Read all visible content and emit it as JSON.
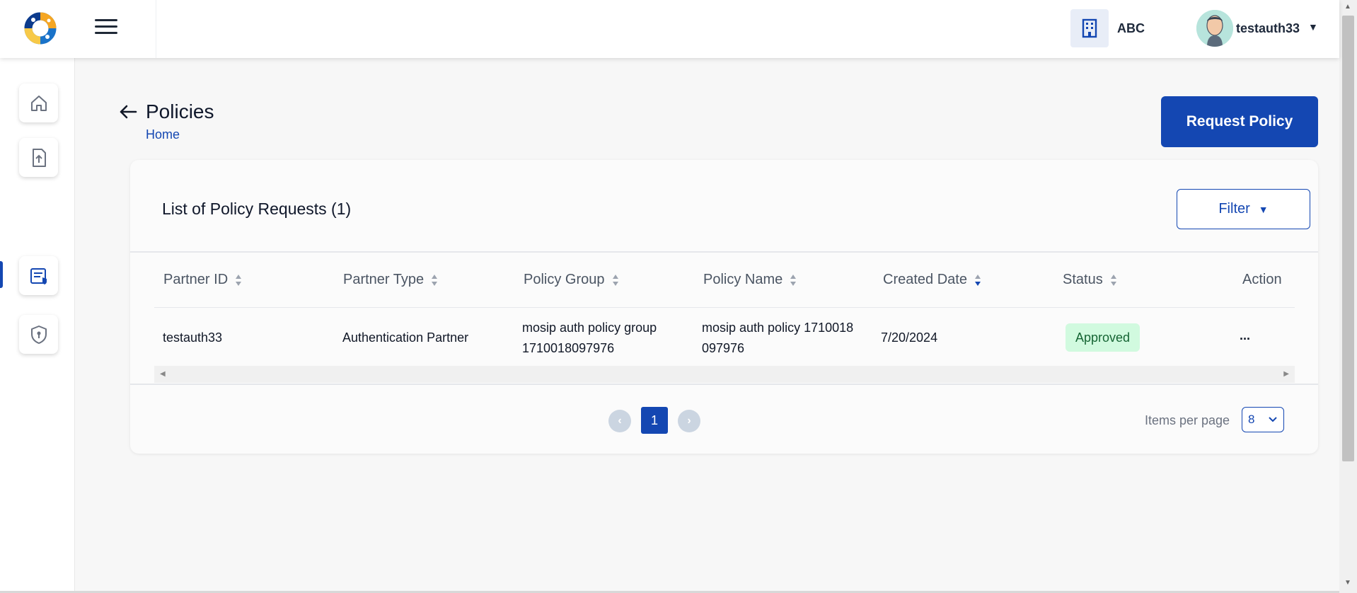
{
  "header": {
    "org_name": "ABC",
    "username": "testauth33",
    "icons": [
      "logo-icon",
      "hamburger-icon",
      "building-icon",
      "avatar",
      "caret-down-icon"
    ]
  },
  "sidebar": {
    "items": [
      {
        "name": "home",
        "icon": "home-icon"
      },
      {
        "name": "upload",
        "icon": "upload-document-icon"
      },
      {
        "name": "policies",
        "icon": "policy-document-icon",
        "active": true
      },
      {
        "name": "security",
        "icon": "shield-icon"
      }
    ]
  },
  "page": {
    "title": "Policies",
    "breadcrumb": "Home",
    "request_button": "Request Policy"
  },
  "list": {
    "title": "List of Policy Requests (1)",
    "filter_label": "Filter",
    "columns": [
      "Partner ID",
      "Partner Type",
      "Policy Group",
      "Policy Name",
      "Created Date",
      "Status",
      "Action"
    ],
    "rows": [
      {
        "partner_id": "testauth33",
        "partner_type": "Authentication Partner",
        "policy_group_line1": "mosip auth policy group",
        "policy_group_line2": "1710018097976",
        "policy_name_line1": "mosip auth policy 1710018",
        "policy_name_line2": "097976",
        "created_date": "7/20/2024",
        "status": "Approved",
        "action": "..."
      }
    ]
  },
  "pagination": {
    "current_page": "1",
    "items_per_page_label": "Items per page",
    "items_per_page_value": "8"
  },
  "colors": {
    "primary": "#1447b2",
    "approved_bg": "#d1fadf",
    "approved_text": "#166534"
  }
}
